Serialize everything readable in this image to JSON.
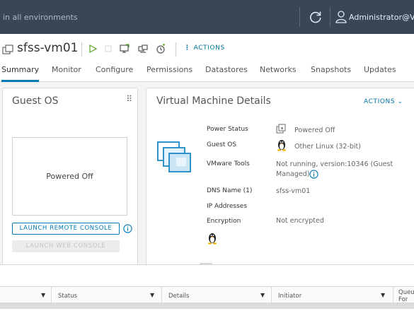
{
  "topbar": {
    "search_text": "in all environments",
    "username": "Administrator@VS",
    "refresh_icon": "refresh-icon",
    "user_icon": "user-icon"
  },
  "header": {
    "vm_name": "sfss-vm01",
    "actions_label": "ACTIONS",
    "tabs": [
      {
        "label": "Summary",
        "active": true
      },
      {
        "label": "Monitor"
      },
      {
        "label": "Configure"
      },
      {
        "label": "Permissions"
      },
      {
        "label": "Datastores"
      },
      {
        "label": "Networks"
      },
      {
        "label": "Snapshots"
      },
      {
        "label": "Updates"
      }
    ],
    "toolbar_icons": [
      "power-on-icon",
      "power-off-icon",
      "launch-console-icon",
      "migrate-icon",
      "snapshot-icon"
    ]
  },
  "guest_os": {
    "title": "Guest OS",
    "console_text": "Powered Off",
    "launch_remote_label": "LAUNCH REMOTE CONSOLE",
    "launch_web_label": "LAUNCH WEB CONSOLE"
  },
  "vm_details": {
    "title": "Virtual Machine Details",
    "actions_label": "ACTIONS",
    "rows": [
      {
        "label": "Power Status",
        "value": "Powered Off"
      },
      {
        "label": "Guest OS",
        "value": "Other Linux (32-bit)"
      },
      {
        "label": "VMware Tools",
        "value": "Not running, version:10346 (Guest",
        "value2": "Managed)"
      },
      {
        "label": "DNS Name (1)",
        "value": "sfss-vm01"
      },
      {
        "label": "IP Addresses",
        "value": ""
      },
      {
        "label": "Encryption",
        "value": "Not encrypted"
      }
    ]
  },
  "tasks": {
    "columns": [
      "Status",
      "Details",
      "Initiator",
      "Queu",
      "For"
    ]
  },
  "colors": {
    "topbar": "#3a4656",
    "accent": "#0079b8",
    "link": "#0072a3"
  }
}
